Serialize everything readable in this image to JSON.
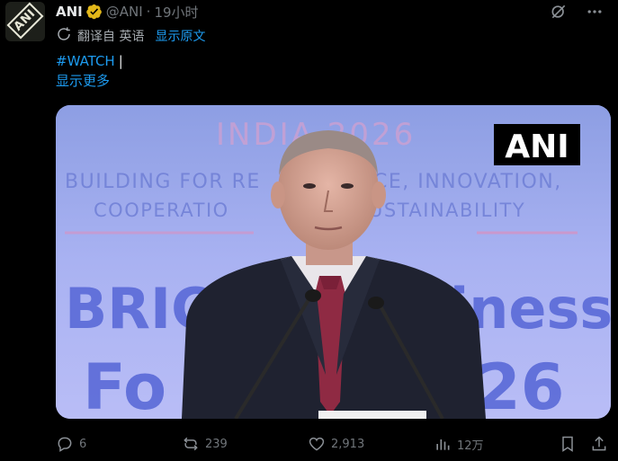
{
  "account": {
    "name": "ANI",
    "handle": "@ANI",
    "separator": "·",
    "time": "19小时",
    "avatar_text": "ANI"
  },
  "translation": {
    "label": "翻译自 英语",
    "show_original": "显示原文"
  },
  "tweet": {
    "hashtag": "#WATCH",
    "caret": "|",
    "show_more": "显示更多"
  },
  "media": {
    "watermark": "ANI",
    "banner_title": "INDIA 2026",
    "banner_line1": "BUILDING FOR RE",
    "banner_line1b": "ICE, INNOVATION,",
    "banner_line2": "COOPERATIO",
    "banner_line2b": "USTAINABILITY",
    "big_text_left": "BRIC",
    "big_text_right": "iness",
    "big_text2_left": "Fo",
    "big_text2_right": "26"
  },
  "actions": {
    "replies": "6",
    "reposts": "239",
    "likes": "2,913",
    "views": "12万"
  },
  "colors": {
    "background": "#000000",
    "accent": "#1d9bf0",
    "muted": "#71767b",
    "verified_gold": "#e2b719"
  }
}
